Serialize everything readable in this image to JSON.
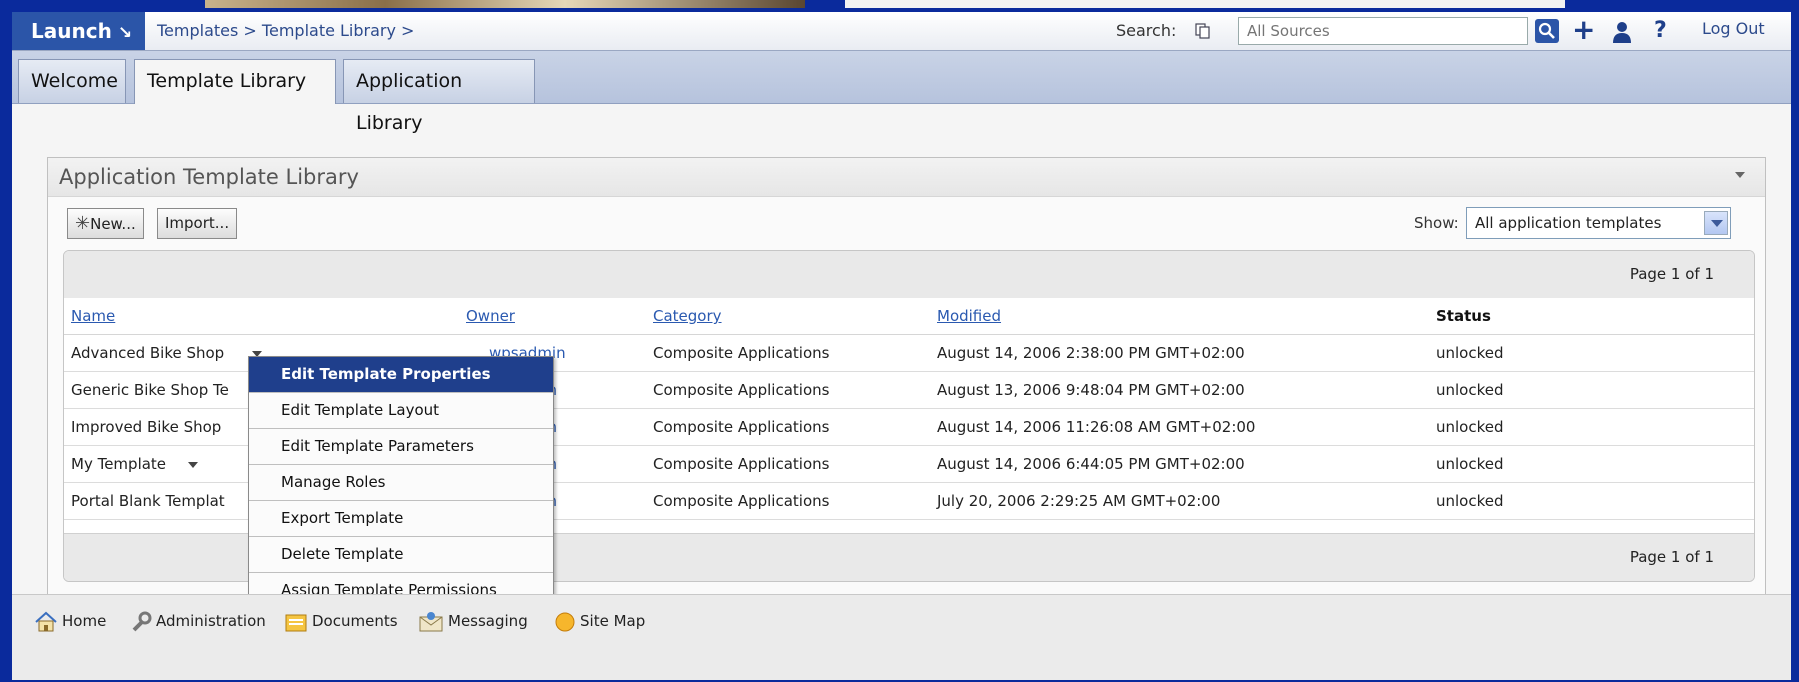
{
  "header": {
    "launch_label": "Launch",
    "breadcrumb": "Templates > Template Library >",
    "search_label": "Search:",
    "search_placeholder": "All Sources",
    "logout_label": "Log Out"
  },
  "tabs": [
    {
      "label": "Welcome"
    },
    {
      "label": "Template Library",
      "selected": true
    },
    {
      "label": "Application Library"
    }
  ],
  "portlet": {
    "title": "Application Template Library",
    "new_button": "New...",
    "import_button": "Import...",
    "show_label": "Show:",
    "show_value": "All application templates",
    "page_indicator": "Page 1 of 1"
  },
  "table": {
    "headers": {
      "name": "Name",
      "owner": "Owner",
      "category": "Category",
      "modified": "Modified",
      "status": "Status"
    },
    "rows": [
      {
        "name": "Advanced Bike Shop",
        "owner": "wpsadmin",
        "category": "Composite Applications",
        "modified": "August 14, 2006 2:38:00 PM GMT+02:00",
        "status": "unlocked"
      },
      {
        "name": "Generic Bike Shop Te",
        "owner": "admin",
        "category": "Composite Applications",
        "modified": "August 13, 2006 9:48:04 PM GMT+02:00",
        "status": "unlocked"
      },
      {
        "name": "Improved Bike Shop",
        "owner": "admin",
        "category": "Composite Applications",
        "modified": "August 14, 2006 11:26:08 AM GMT+02:00",
        "status": "unlocked"
      },
      {
        "name": "My Template",
        "owner": "admin",
        "category": "Composite Applications",
        "modified": "August 14, 2006 6:44:05 PM GMT+02:00",
        "status": "unlocked"
      },
      {
        "name": "Portal Blank Templat",
        "owner": "admin",
        "category": "Composite Applications",
        "modified": "July 20, 2006 2:29:25 AM GMT+02:00",
        "status": "unlocked"
      }
    ]
  },
  "context_menu": {
    "items": [
      "Edit Template Properties",
      "Edit Template Layout",
      "Edit Template Parameters",
      "Manage Roles",
      "Export Template",
      "Delete Template",
      "Assign Template Permissions"
    ]
  },
  "footer_nav": [
    {
      "label": "Home",
      "icon": "home-icon"
    },
    {
      "label": "Administration",
      "icon": "wrench-icon"
    },
    {
      "label": "Documents",
      "icon": "documents-icon"
    },
    {
      "label": "Messaging",
      "icon": "messaging-icon"
    },
    {
      "label": "Site Map",
      "icon": "compass-icon"
    }
  ],
  "colors": {
    "accent": "#2b55a8",
    "menu_highlight": "#1f3f8c",
    "link": "#2a59b0",
    "background": "#0a2a9c"
  }
}
